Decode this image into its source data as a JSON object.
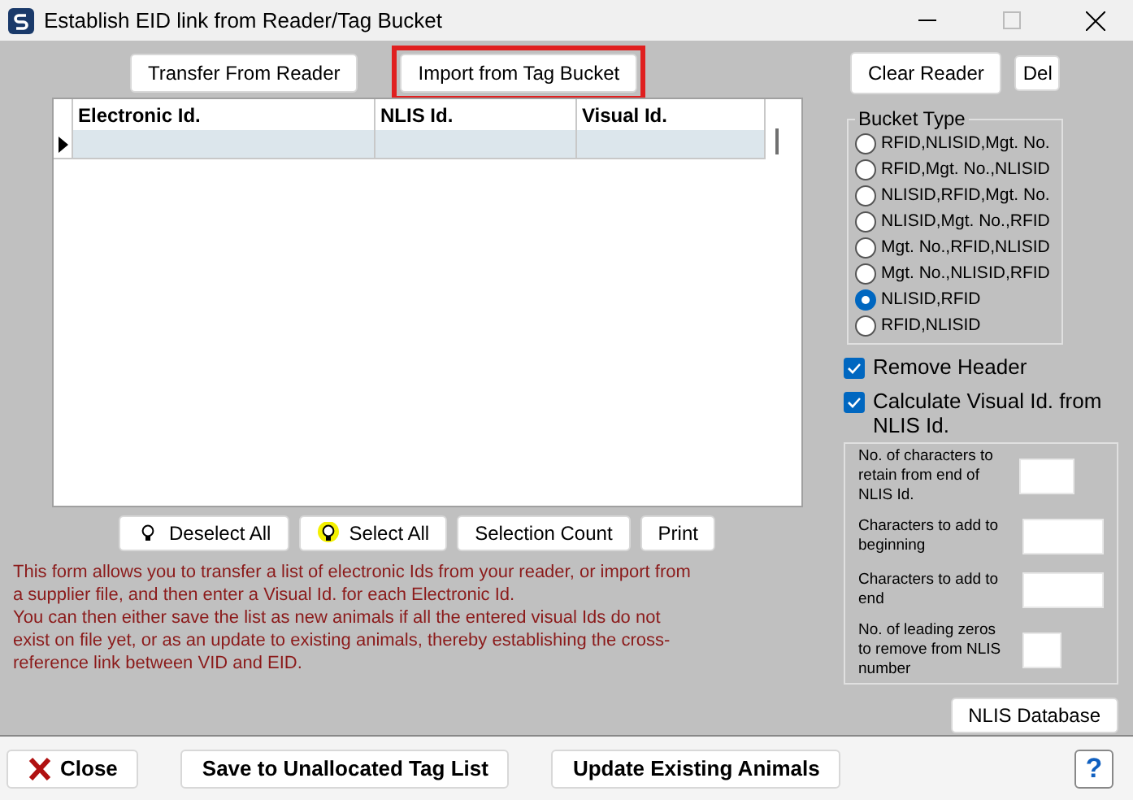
{
  "window": {
    "title": "Establish EID link from Reader/Tag Bucket"
  },
  "top_buttons": [
    {
      "label": "Transfer From Reader",
      "highlighted": false
    },
    {
      "label": "Import from Tag Bucket",
      "highlighted": true
    }
  ],
  "right_buttons": [
    "Clear Reader",
    "Del"
  ],
  "table": {
    "columns": [
      "Electronic Id.",
      "NLIS Id.",
      "Visual Id."
    ],
    "rows": [
      {
        "selected": true,
        "cells": [
          "",
          "",
          ""
        ]
      }
    ]
  },
  "list_buttons": [
    {
      "label": "Deselect All",
      "kind": "bulb-off"
    },
    {
      "label": "Select All",
      "kind": "bulb-on"
    },
    {
      "label": "Selection Count",
      "kind": "plain"
    },
    {
      "label": "Print",
      "kind": "plain"
    }
  ],
  "description": [
    "This form allows you to transfer a list of electronic Ids from your reader, or import from a supplier file, and then enter a Visual Id. for each Electronic Id.",
    "You can then either save the list as new animals if all the entered visual Ids do not exist on file yet, or as an update to existing animals, thereby establishing the cross-reference link between VID and EID."
  ],
  "bucket_type": {
    "title": "Bucket Type",
    "options": [
      {
        "label": "RFID,NLISID,Mgt. No.",
        "selected": false
      },
      {
        "label": "RFID,Mgt. No.,NLISID",
        "selected": false
      },
      {
        "label": "NLISID,RFID,Mgt. No.",
        "selected": false
      },
      {
        "label": "NLISID,Mgt. No.,RFID",
        "selected": false
      },
      {
        "label": "Mgt. No.,RFID,NLISID",
        "selected": false
      },
      {
        "label": "Mgt. No.,NLISID,RFID",
        "selected": false
      },
      {
        "label": "NLISID,RFID",
        "selected": true
      },
      {
        "label": "RFID,NLISID",
        "selected": false
      }
    ]
  },
  "options": [
    {
      "label": "Remove Header",
      "checked": true
    },
    {
      "label": "Calculate Visual Id. from NLIS Id.",
      "checked": true
    }
  ],
  "settings": [
    {
      "label": "No. of characters to retain from end of NLIS Id."
    },
    {
      "label": "Characters to add to beginning"
    },
    {
      "label": "Characters to add to end"
    },
    {
      "label": "No. of leading zeros to remove from NLIS number"
    }
  ],
  "nlis_button": "NLIS Database",
  "footer_buttons": [
    {
      "label": "Close",
      "kind": "close"
    },
    {
      "label": "Save to Unallocated Tag List",
      "kind": "plain"
    },
    {
      "label": "Update Existing Animals",
      "kind": "plain"
    }
  ],
  "help_button": "?"
}
